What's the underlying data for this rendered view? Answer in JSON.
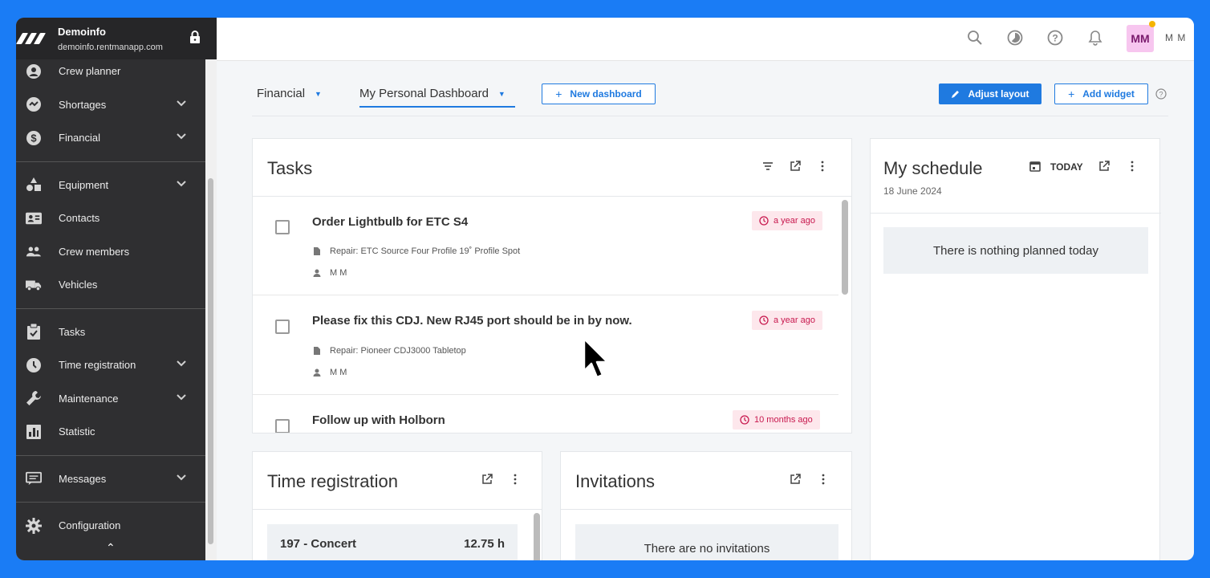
{
  "app": {
    "name": "Demoinfo",
    "domain": "demoinfo.rentmanapp.com"
  },
  "sidebar": {
    "groups": [
      [
        {
          "label": "Crew planner",
          "icon": "person-circle-icon",
          "chevron": false
        },
        {
          "label": "Shortages",
          "icon": "shortage-icon",
          "chevron": true
        },
        {
          "label": "Financial",
          "icon": "dollar-circle-icon",
          "chevron": true
        }
      ],
      [
        {
          "label": "Equipment",
          "icon": "shapes-icon",
          "chevron": true
        },
        {
          "label": "Contacts",
          "icon": "contact-card-icon",
          "chevron": false
        },
        {
          "label": "Crew members",
          "icon": "people-icon",
          "chevron": false
        },
        {
          "label": "Vehicles",
          "icon": "truck-icon",
          "chevron": false
        }
      ],
      [
        {
          "label": "Tasks",
          "icon": "clipboard-check-icon",
          "chevron": false
        },
        {
          "label": "Time registration",
          "icon": "clock-icon",
          "chevron": true
        },
        {
          "label": "Maintenance",
          "icon": "wrench-icon",
          "chevron": true
        },
        {
          "label": "Statistic",
          "icon": "bar-chart-icon",
          "chevron": false
        }
      ],
      [
        {
          "label": "Messages",
          "icon": "message-icon",
          "chevron": true
        }
      ],
      [
        {
          "label": "Configuration",
          "icon": "gear-icon",
          "chevron": false
        }
      ]
    ]
  },
  "topbar": {
    "avatar": "MM",
    "user": "M M"
  },
  "dashboard": {
    "tabs": [
      "Financial",
      "My Personal Dashboard"
    ],
    "new_dashboard": "New dashboard",
    "adjust_layout": "Adjust layout",
    "add_widget": "Add widget"
  },
  "tasks_widget": {
    "title": "Tasks",
    "items": [
      {
        "title": "Order Lightbulb for ETC S4",
        "repair": "Repair: ETC Source Four Profile 19˚ Profile Spot",
        "assignee": "M M",
        "due": "a year ago"
      },
      {
        "title": "Please fix this CDJ. New RJ45 port should be in by now.",
        "repair": "Repair: Pioneer CDJ3000 Tabletop",
        "assignee": "M M",
        "due": "a year ago"
      },
      {
        "title": "Follow up with Holborn",
        "due": "10 months ago"
      }
    ]
  },
  "schedule_widget": {
    "title": "My schedule",
    "date": "18 June 2024",
    "today": "TODAY",
    "empty": "There is nothing planned today"
  },
  "time_widget": {
    "title": "Time registration",
    "row_label": "197 - Concert",
    "row_value": "12.75 h"
  },
  "invitations_widget": {
    "title": "Invitations",
    "empty": "There are no invitations"
  },
  "colors": {
    "accent": "#1f7ae0",
    "sidebar": "#2f2f31",
    "badge_bg": "#fde7ec",
    "badge_fg": "#c8184e",
    "outer_bg": "#1a7cf5"
  }
}
